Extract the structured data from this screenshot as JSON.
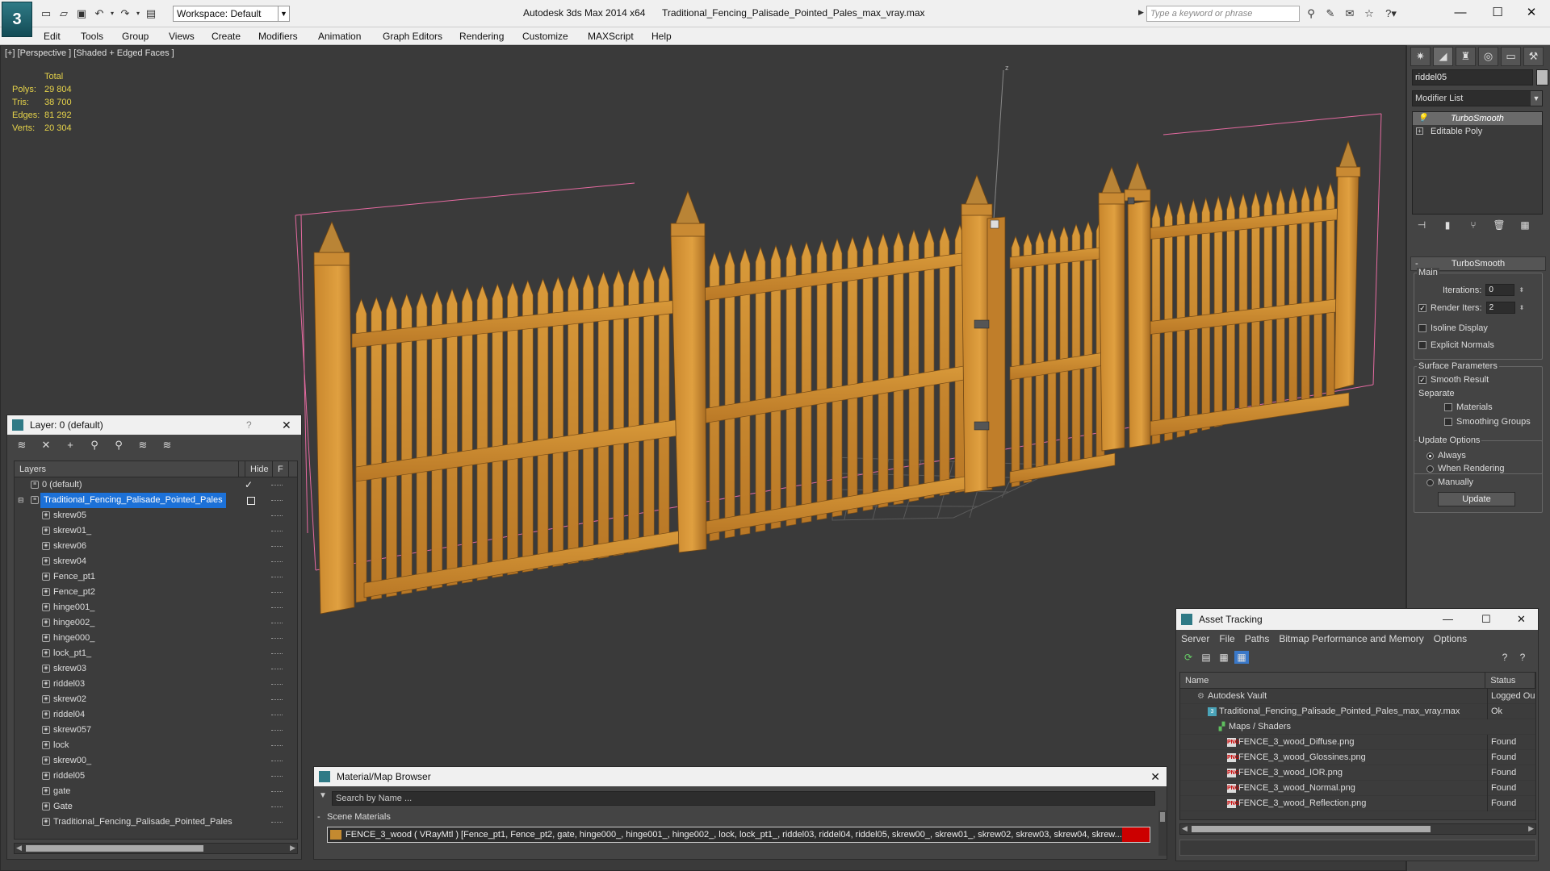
{
  "titlebar": {
    "app_title": "Autodesk 3ds Max  2014 x64",
    "file_title": "Traditional_Fencing_Palisade_Pointed_Pales_max_vray.max",
    "workspace": "Workspace: Default",
    "search_placeholder": "Type a keyword or phrase",
    "logo": "3"
  },
  "menu": [
    "Edit",
    "Tools",
    "Group",
    "Views",
    "Create",
    "Modifiers",
    "Animation",
    "Graph Editors",
    "Rendering",
    "Customize",
    "MAXScript",
    "Help"
  ],
  "viewport": {
    "label": "[+] [Perspective ] [Shaded + Edged Faces ]",
    "axis_label": "z",
    "stats": {
      "header": "Total",
      "rows": [
        {
          "k": "Polys:",
          "v": "29 804"
        },
        {
          "k": "Tris:",
          "v": "38 700"
        },
        {
          "k": "Edges:",
          "v": "81 292"
        },
        {
          "k": "Verts:",
          "v": "20 304"
        }
      ]
    }
  },
  "command_panel": {
    "object_name": "riddel05",
    "modifier_list": "Modifier List",
    "stack": [
      "TurboSmooth",
      "Editable Poly"
    ],
    "rollout_title": "TurboSmooth",
    "main_label": "Main",
    "iterations_label": "Iterations:",
    "iterations_value": "0",
    "render_iters_label": "Render Iters:",
    "render_iters_value": "2",
    "isoline_label": "Isoline Display",
    "explicit_label": "Explicit Normals",
    "surface_label": "Surface Parameters",
    "smooth_label": "Smooth Result",
    "separate_label": "Separate",
    "materials_label": "Materials",
    "smoothing_label": "Smoothing Groups",
    "update_options_label": "Update Options",
    "always_label": "Always",
    "when_rendering_label": "When Rendering",
    "manually_label": "Manually",
    "update_button": "Update"
  },
  "layer_panel": {
    "title": "Layer: 0 (default)",
    "help": "?",
    "col_layers": "Layers",
    "col_hide": "Hide",
    "col_f": "F",
    "layer0": "0 (default)",
    "layer1": "Traditional_Fencing_Palisade_Pointed_Pales",
    "objects": [
      "skrew05",
      "skrew01_",
      "skrew06",
      "skrew04",
      "Fence_pt1",
      "Fence_pt2",
      "hinge001_",
      "hinge002_",
      "hinge000_",
      "lock_pt1_",
      "skrew03",
      "riddel03",
      "skrew02",
      "riddel04",
      "skrew057",
      "lock",
      "skrew00_",
      "riddel05",
      "gate",
      "Gate",
      "Traditional_Fencing_Palisade_Pointed_Pales"
    ]
  },
  "material_browser": {
    "title": "Material/Map Browser",
    "search_placeholder": "Search by Name ...",
    "section": "Scene Materials",
    "row": "FENCE_3_wood  ( VRayMtl ) [Fence_pt1, Fence_pt2, gate, hinge000_, hinge001_, hinge002_, lock, lock_pt1_, riddel03, riddel04, riddel05, skrew00_, skrew01_, skrew02, skrew03, skrew04, skrew..."
  },
  "asset_tracking": {
    "title": "Asset Tracking",
    "menu": [
      "Server",
      "File",
      "Paths",
      "Bitmap Performance and Memory",
      "Options"
    ],
    "col_name": "Name",
    "col_status": "Status",
    "rows": [
      {
        "name": "Autodesk Vault",
        "status": "Logged Ou",
        "icon": "vault"
      },
      {
        "name": "Traditional_Fencing_Palisade_Pointed_Pales_max_vray.max",
        "status": "Ok",
        "icon": "max"
      },
      {
        "name": "Maps / Shaders",
        "status": "",
        "icon": "maps"
      },
      {
        "name": "FENCE_3_wood_Diffuse.png",
        "status": "Found",
        "icon": "png"
      },
      {
        "name": "FENCE_3_wood_Glossines.png",
        "status": "Found",
        "icon": "png"
      },
      {
        "name": "FENCE_3_wood_IOR.png",
        "status": "Found",
        "icon": "png"
      },
      {
        "name": "FENCE_3_wood_Normal.png",
        "status": "Found",
        "icon": "png"
      },
      {
        "name": "FENCE_3_wood_Reflection.png",
        "status": "Found",
        "icon": "png"
      }
    ]
  }
}
